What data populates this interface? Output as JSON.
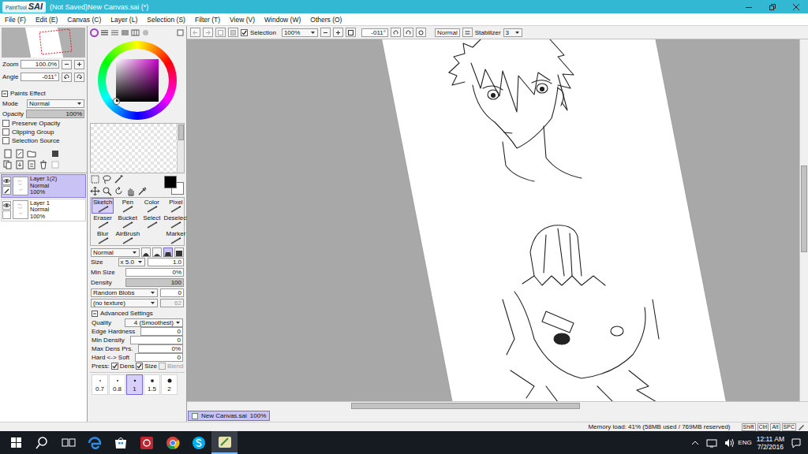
{
  "window": {
    "logo_small": "PaintTool",
    "logo_big": "SAI",
    "title": "(Not Saved)New Canvas.sai (*)"
  },
  "menu": [
    {
      "label": "File (F)"
    },
    {
      "label": "Edit (E)"
    },
    {
      "label": "Canvas (C)"
    },
    {
      "label": "Layer (L)"
    },
    {
      "label": "Selection (S)"
    },
    {
      "label": "Filter (T)"
    },
    {
      "label": "View (V)"
    },
    {
      "label": "Window (W)"
    },
    {
      "label": "Others (O)"
    }
  ],
  "navigator": {
    "zoom_label": "Zoom",
    "zoom": "100.0%",
    "angle_label": "Angle",
    "angle": "-011°"
  },
  "paints_effect": {
    "title": "Paints Effect",
    "expanded": true,
    "mode_label": "Mode",
    "mode": "Normal",
    "opacity_label": "Opacity",
    "opacity": "100%",
    "opacity_level": 1,
    "options": [
      {
        "label": "Preserve Opacity",
        "checked": false
      },
      {
        "label": "Clipping Group",
        "checked": false
      },
      {
        "label": "Selection Source",
        "checked": false
      }
    ]
  },
  "layers": [
    {
      "name": "Layer 1(2)",
      "mode": "Normal",
      "opacity": "100%",
      "selected": true,
      "visible": true
    },
    {
      "name": "Layer 1",
      "mode": "Normal",
      "opacity": "100%",
      "selected": false,
      "visible": true
    }
  ],
  "color": {
    "hue": "#c800c8",
    "primary": "#000000",
    "secondary": "#ffffff"
  },
  "tools": [
    [
      {
        "label": "Sketch",
        "selected": true
      },
      {
        "label": "Pen",
        "selected": false
      },
      {
        "label": "Color",
        "selected": false
      },
      {
        "label": "Pixel",
        "selected": false
      }
    ],
    [
      {
        "label": "Eraser",
        "selected": false
      },
      {
        "label": "Bucket",
        "selected": false
      },
      {
        "label": "Select",
        "selected": false
      },
      {
        "label": "Deselect",
        "selected": false
      }
    ],
    [
      {
        "label": "Blur",
        "selected": false
      },
      {
        "label": "AirBrush",
        "selected": false
      },
      null,
      {
        "label": "Marker",
        "selected": false
      }
    ]
  ],
  "brush": {
    "mode": "Normal",
    "shapes": [
      {
        "selected": false
      },
      {
        "selected": false
      },
      {
        "selected": true
      },
      {
        "selected": false
      }
    ],
    "size_label": "Size",
    "size_scale": "x 5.0",
    "size": "1.0",
    "min_size_label": "Min Size",
    "min_size": "0%",
    "min_size_level": 0,
    "density_label": "Density",
    "density": "100",
    "density_level": 1,
    "shape": "Random Blobs",
    "shape_value": "0",
    "texture": "(no texture)",
    "texture_value": "62",
    "texture_value_disabled": true
  },
  "advanced": {
    "title": "Advanced Settings",
    "expanded": true,
    "quality_label": "Quality",
    "quality": "4 (Smoothest)",
    "rows": [
      {
        "label": "Edge Hardness",
        "value": "0"
      },
      {
        "label": "Min Density",
        "value": "0"
      },
      {
        "label": "Max Dens Prs.",
        "value": "0%"
      },
      {
        "label": "Hard <-> Soft",
        "value": "0"
      }
    ],
    "press_label": "Press:",
    "press": [
      {
        "label": "Dens",
        "checked": true,
        "disabled": false
      },
      {
        "label": "Size",
        "checked": true,
        "disabled": false
      },
      {
        "label": "Blend",
        "checked": false,
        "disabled": true
      }
    ]
  },
  "brush_sizes": [
    {
      "label": "0.7",
      "selected": false
    },
    {
      "label": "0.8",
      "selected": false
    },
    {
      "label": "1",
      "selected": true
    },
    {
      "label": "1.5",
      "selected": false
    },
    {
      "label": "2",
      "selected": false
    }
  ],
  "canvas_toolbar": {
    "selection_label": "Selection",
    "selection_checked": true,
    "zoom": "100%",
    "angle": "-011°",
    "blend": "Normal",
    "stabilizer_label": "Stabilizer",
    "stabilizer": "3"
  },
  "file_tabs": [
    {
      "label": "New Canvas.sai",
      "zoom": "100%",
      "selected": true
    }
  ],
  "status_bar": {
    "memory": "Memory load: 41% (58MB used / 769MB reserved)",
    "keys": [
      {
        "label": "Shift",
        "pressed": false
      },
      {
        "label": "Ctrl",
        "pressed": false
      },
      {
        "label": "Alt",
        "pressed": false
      },
      {
        "label": "SPC",
        "pressed": false
      }
    ]
  },
  "taskbar": {
    "language": "ENG",
    "time": "12:11 AM",
    "date": "7/2/2016"
  }
}
